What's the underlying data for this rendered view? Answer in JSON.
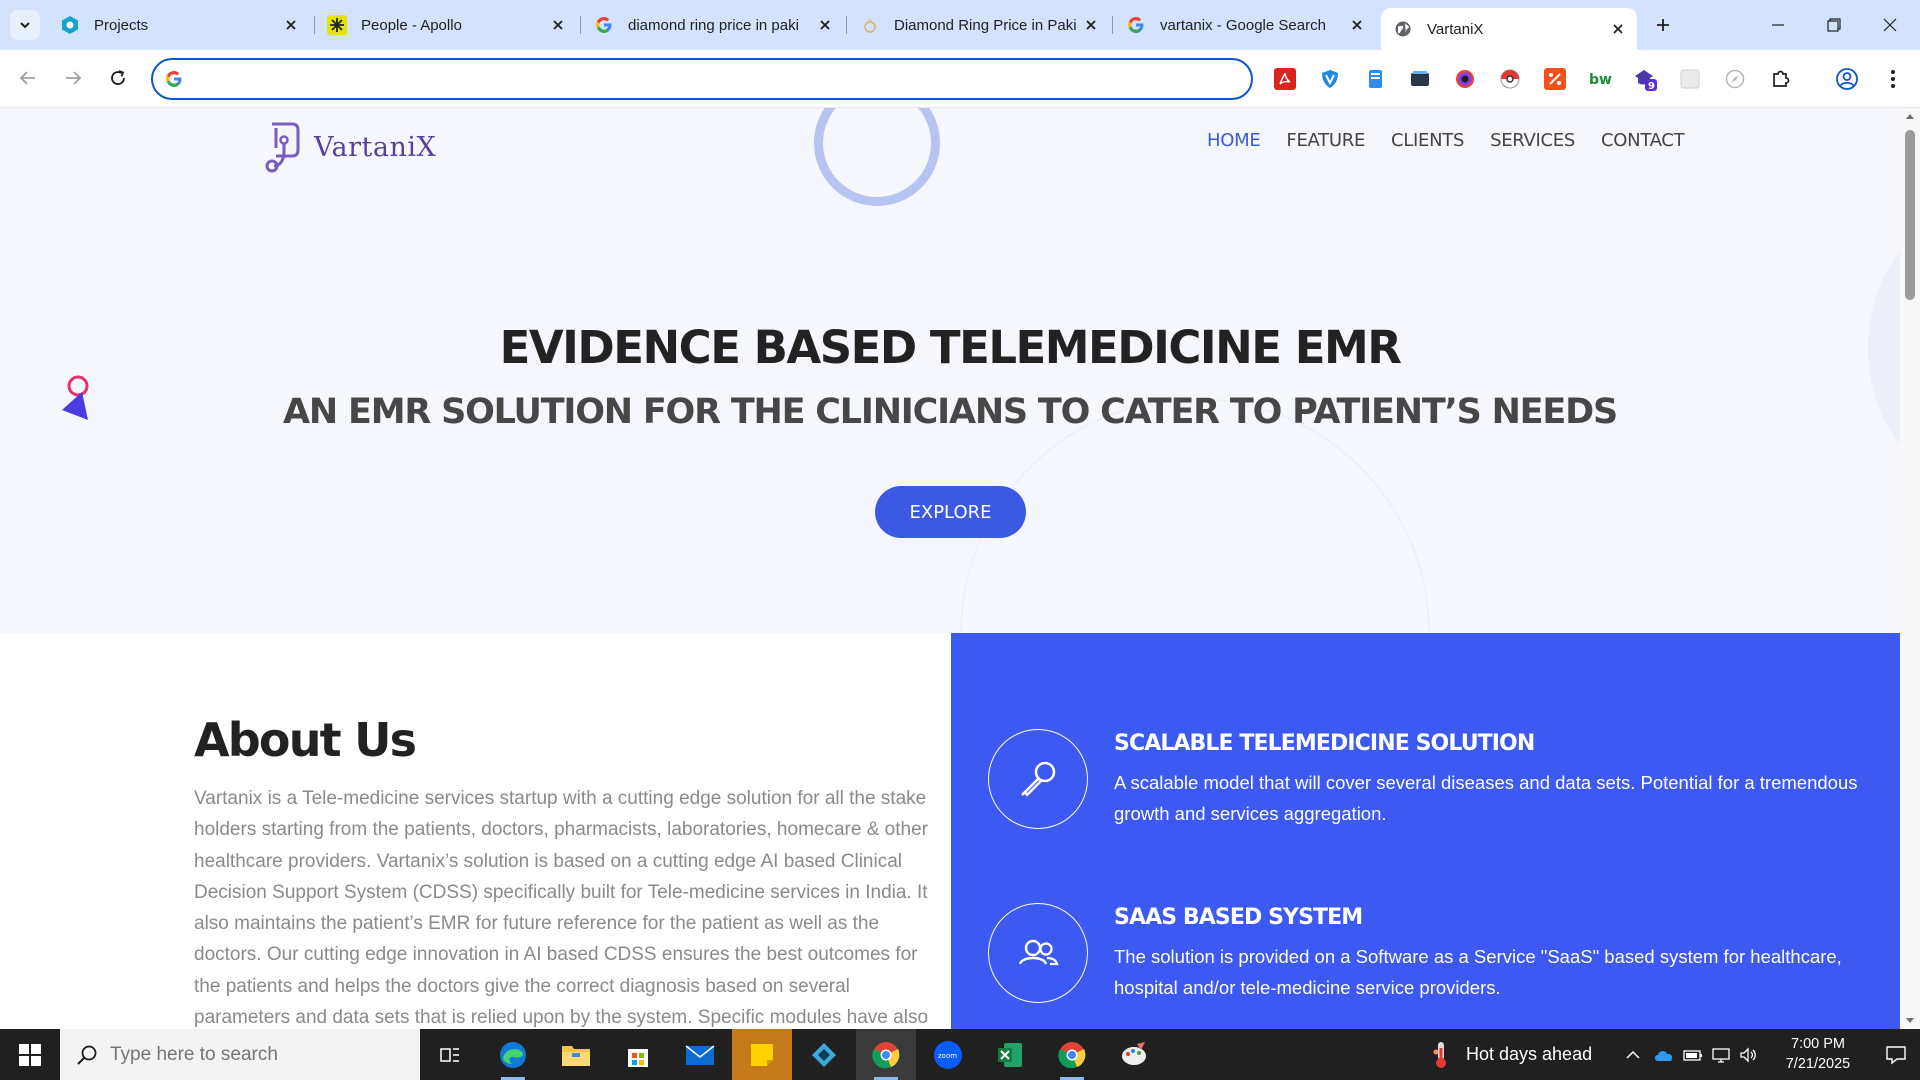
{
  "browser": {
    "tabs": [
      {
        "title": "Projects",
        "icon": "projects-favicon",
        "color": "#1aa3c9"
      },
      {
        "title": "People - Apollo",
        "icon": "apollo-favicon",
        "color": "#d9d900"
      },
      {
        "title": "diamond ring price in paki",
        "icon": "google-favicon",
        "color": "#4285f4"
      },
      {
        "title": "Diamond Ring Price in Paki",
        "icon": "ring-favicon",
        "color": "#e0b070"
      },
      {
        "title": "vartanix - Google Search",
        "icon": "google-favicon",
        "color": "#4285f4"
      },
      {
        "title": "VartaniX",
        "icon": "globe-favicon",
        "active": true
      }
    ],
    "omnibox": {
      "value": "",
      "placeholder": ""
    },
    "extension_badge": "9"
  },
  "site": {
    "logo_text": "VartaniX",
    "nav": [
      "HOME",
      "FEATURE",
      "CLIENTS",
      "SERVICES",
      "CONTACT"
    ],
    "hero": {
      "title": "EVIDENCE BASED TELEMEDICINE EMR",
      "subtitle": "AN EMR SOLUTION FOR THE CLINICIANS TO CATER TO PATIENT’S NEEDS",
      "button": "EXPLORE"
    },
    "about": {
      "heading": "About Us",
      "body": "Vartanix is a Tele-medicine services startup with a cutting edge solution for all the stake holders starting from the patients, doctors, pharmacists, laboratories, homecare & other healthcare providers. Vartanix’s solution is based on a cutting edge AI based Clinical Decision Support System (CDSS) specifically built for Tele-medicine services in India. It also maintains the patient’s EMR for future reference for the patient as well as the doctors. Our cutting edge innovation in AI based CDSS ensures the best outcomes for the patients and helps the doctors give the correct diagnosis based on several parameters and data sets that is relied upon by the system. Specific modules have also been built for the other stake"
    },
    "features": [
      {
        "title": "SCALABLE TELEMEDICINE SOLUTION",
        "text": "A scalable model that will cover several diseases and data sets. Potential for a tremendous growth and services aggregation.",
        "icon": "microphone-icon"
      },
      {
        "title": "SAAS BASED SYSTEM",
        "text": "The solution is provided on a Software as a Service \"SaaS\" based system for healthcare, hospital and/or tele-medicine service providers.",
        "icon": "users-icon"
      }
    ],
    "colors": {
      "primary": "#3c59f2",
      "button": "#3c59e4",
      "nav_active": "#3b5bdb"
    }
  },
  "taskbar": {
    "search_placeholder": "Type here to search",
    "weather": "Hot days ahead",
    "time": "7:00 PM",
    "date": "7/21/2025"
  }
}
